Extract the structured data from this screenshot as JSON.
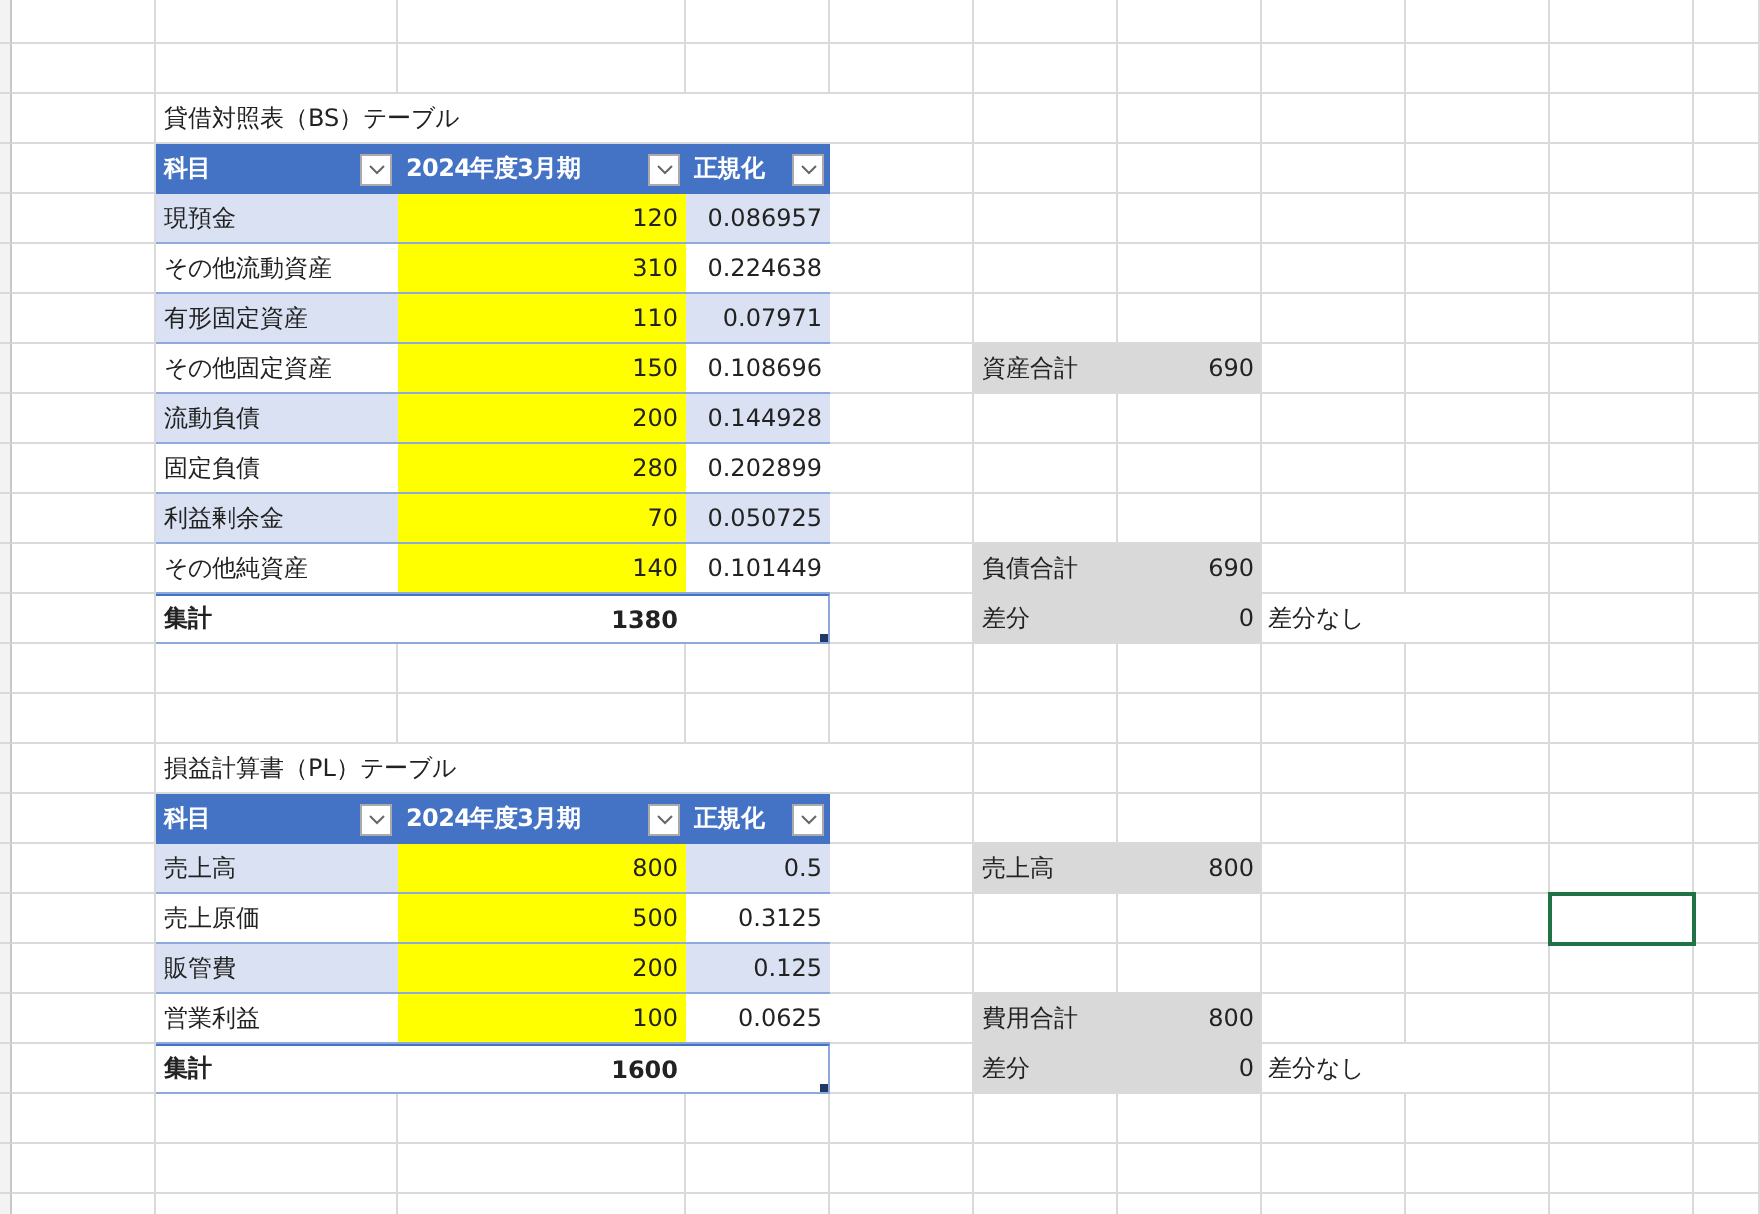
{
  "tables": [
    {
      "title": "貸借対照表（BS）テーブル",
      "columns": [
        "科目",
        "2024年度3月期",
        "正規化"
      ],
      "rows": [
        {
          "item": "現預金",
          "value": "120",
          "ratio": "0.086957"
        },
        {
          "item": "その他流動資産",
          "value": "310",
          "ratio": "0.224638"
        },
        {
          "item": "有形固定資産",
          "value": "110",
          "ratio": "0.07971"
        },
        {
          "item": "その他固定資産",
          "value": "150",
          "ratio": "0.108696"
        },
        {
          "item": "流動負債",
          "value": "200",
          "ratio": "0.144928"
        },
        {
          "item": "固定負債",
          "value": "280",
          "ratio": "0.202899"
        },
        {
          "item": "利益剰余金",
          "value": "70",
          "ratio": "0.050725"
        },
        {
          "item": "その他純資産",
          "value": "140",
          "ratio": "0.101449"
        }
      ],
      "total": {
        "label": "集計",
        "value": "1380"
      },
      "summary": [
        {
          "label": "資産合計",
          "value": "690"
        },
        {
          "label": "負債合計",
          "value": "690"
        },
        {
          "label": "差分",
          "value": "0",
          "note": "差分なし"
        }
      ]
    },
    {
      "title": "損益計算書（PL）テーブル",
      "columns": [
        "科目",
        "2024年度3月期",
        "正規化"
      ],
      "rows": [
        {
          "item": "売上高",
          "value": "800",
          "ratio": "0.5"
        },
        {
          "item": "売上原価",
          "value": "500",
          "ratio": "0.3125"
        },
        {
          "item": "販管費",
          "value": "200",
          "ratio": "0.125"
        },
        {
          "item": "営業利益",
          "value": "100",
          "ratio": "0.0625"
        }
      ],
      "total": {
        "label": "集計",
        "value": "1600"
      },
      "summary": [
        {
          "label": "売上高",
          "value": "800"
        },
        {
          "label": "費用合計",
          "value": "800"
        },
        {
          "label": "差分",
          "value": "0",
          "note": "差分なし"
        }
      ]
    }
  ],
  "cell_cursor": {
    "selected": true
  }
}
